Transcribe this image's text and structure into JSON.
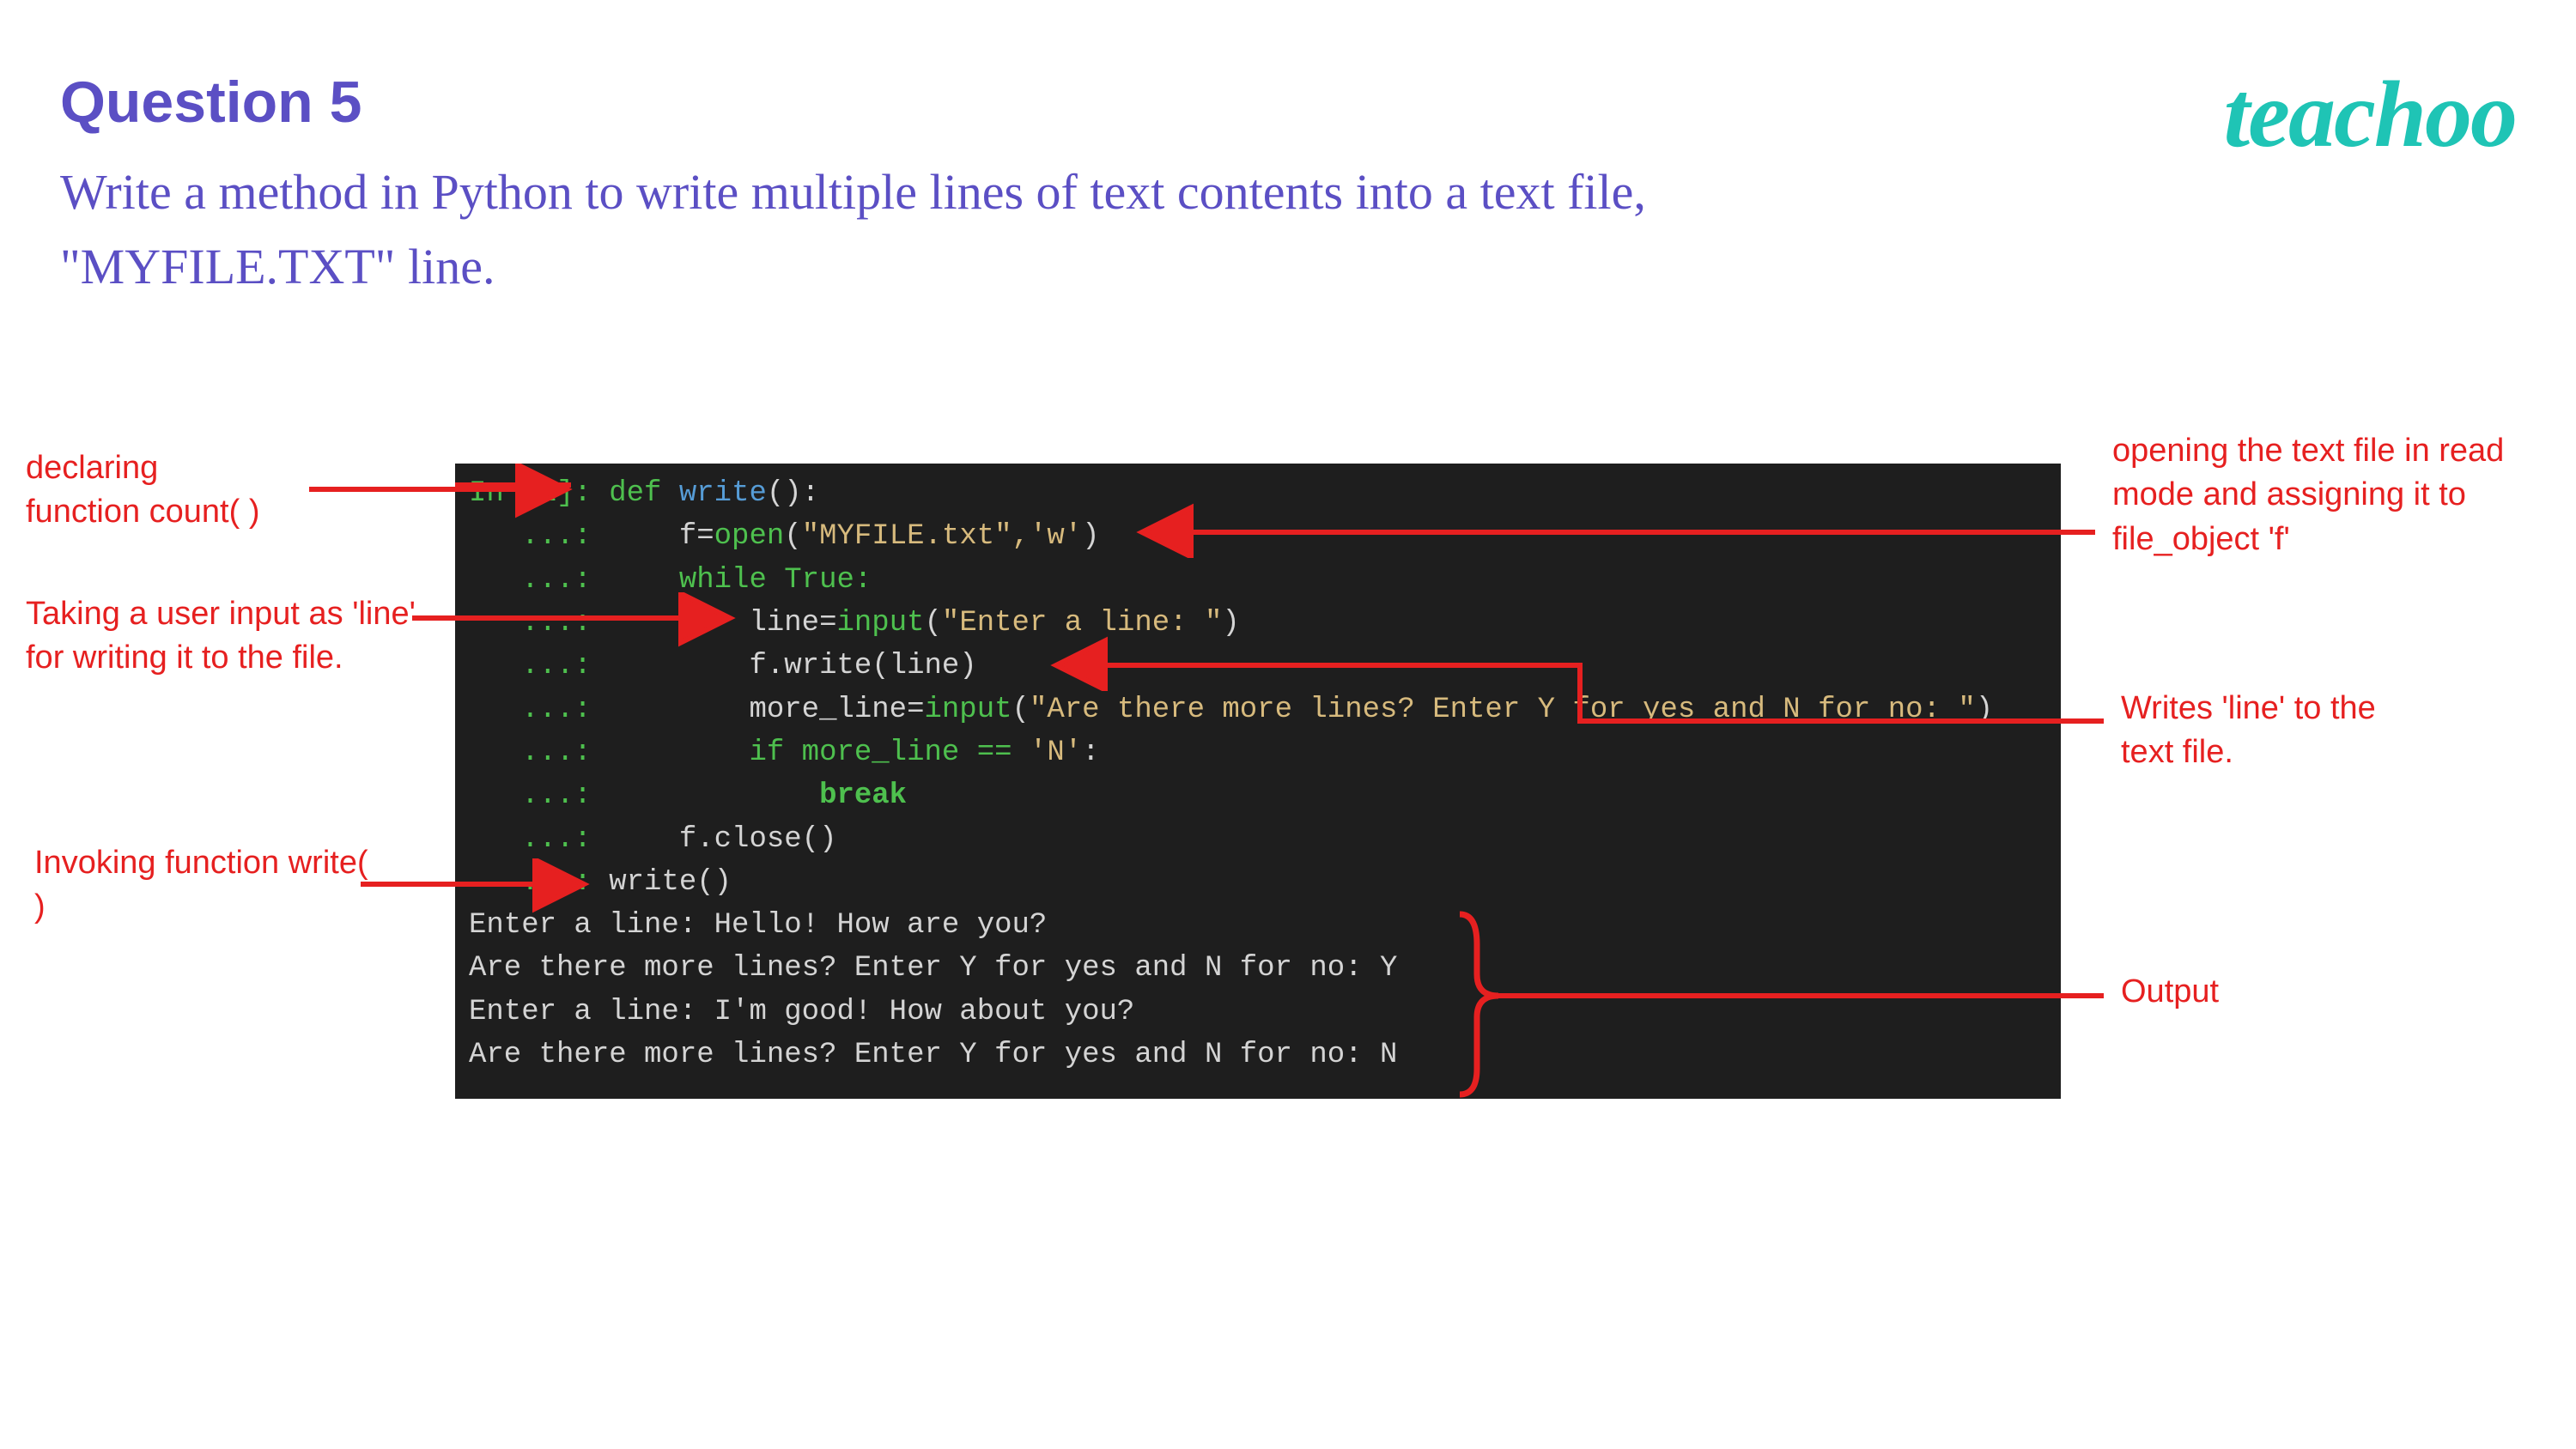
{
  "header": {
    "title": "Question 5",
    "prompt": "Write a method in Python to write multiple lines  of text contents into a text file, \"MYFILE.TXT\" line.",
    "logo": "teachoo"
  },
  "code": {
    "prompt_in": "In [1]:",
    "cont": "   ...:",
    "line1_def": " def ",
    "line1_name": "write",
    "line1_tail": "():",
    "line2_a": "     f=",
    "line2_open": "open",
    "line2_b": "(",
    "line2_str": "\"MYFILE.txt\",'w'",
    "line2_c": ")",
    "line3": "     while True:",
    "line4_a": "         line=",
    "line4_input": "input",
    "line4_b": "(",
    "line4_str": "\"Enter a line: \"",
    "line4_c": ")",
    "line5": "         f.write(line)",
    "line6_a": "         more_line=",
    "line6_input": "input",
    "line6_b": "(",
    "line6_str": "\"Are there more lines? Enter Y for yes and N for no: \"",
    "line6_c": ")",
    "line7_a": "         if more_line == ",
    "line7_str": "'N'",
    "line7_b": ":",
    "line8": "             break",
    "line9": "     f.close()",
    "line10": " write()",
    "out1": "Enter a line: Hello! How are you?",
    "out2": "Are there more lines? Enter Y for yes and N for no: Y",
    "out3": "Enter a line: I'm good! How about you?",
    "out4": "Are there more lines? Enter Y for yes and N for no: N"
  },
  "annotations": {
    "declare": "declaring\nfunction count( )",
    "user_input": "Taking a user input as 'line' for writing it to the file.",
    "invoke": "Invoking function write( )",
    "opening": "opening the text file in read mode and assigning it to file_object 'f'",
    "writes": "Writes 'line' to the text file.",
    "output": "Output"
  }
}
